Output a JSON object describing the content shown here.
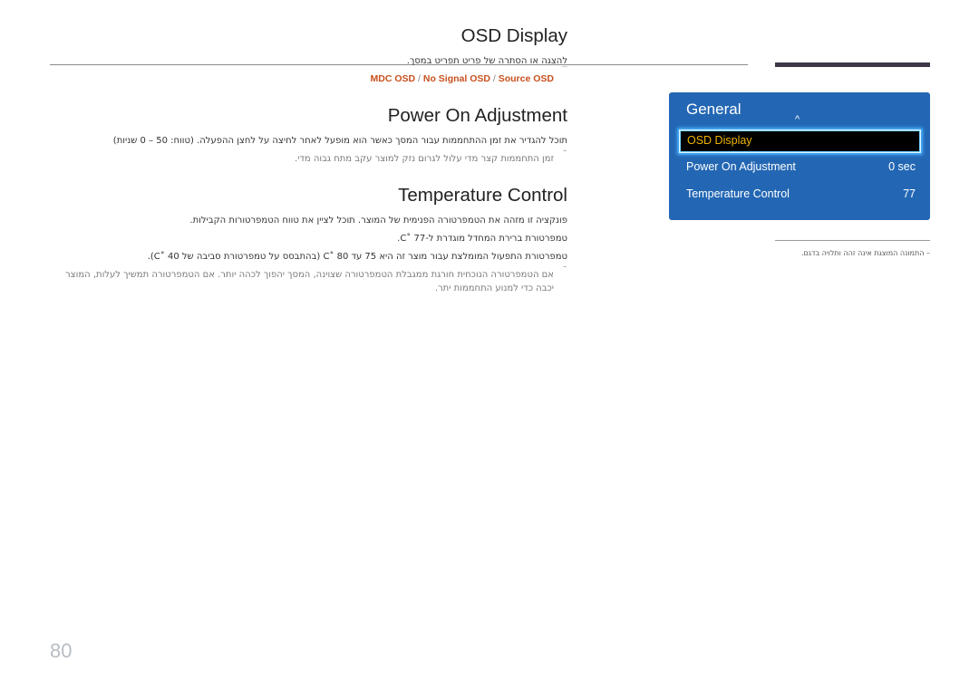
{
  "page_number": "80",
  "sections": {
    "osd_display": {
      "title": "OSD Display",
      "body": "להצגה או הסתרה של פריט תפריט במסך.",
      "options": [
        "MDC OSD",
        "No Signal OSD",
        "Source OSD"
      ],
      "separator": "/"
    },
    "power_on": {
      "title": "Power On Adjustment",
      "body": "תוכל להגדיר את זמן ההתחממות עבור המסך כאשר הוא מופעל לאחר לחיצה על לחצן ההפעלה. (טווח: 50 – 0 שניות)",
      "note": "זמן התחממות קצר מדי עלול לגרום נזק למוצר עקב מתח גבוה מדי."
    },
    "temperature": {
      "title": "Temperature Control",
      "body1": "פונקציה זו מזהה את הטמפרטורה הפנימית של המוצר. תוכל לציין את טווח הטמפרטורות הקבילות.",
      "body2": "טמפרטורת ברירת המחדל מוגדרת ל-C˚ 77.",
      "body3": "טמפרטורת התפעול המומלצת עבור מוצר זה היא 75 עד C˚ 80 (בהתבסס על טמפרטורת סביבה של C˚ 40).",
      "note_line1": "אם הטמפרטורה הנוכחית חורגת ממגבלת הטמפרטורה שצוינה, המסך יהפוך לכהה יותר. אם הטמפרטורה תמשיך לעלות, המוצר",
      "note_line2": "יכבה כדי למנוע התחממות יתר."
    }
  },
  "menu_panel": {
    "title": "General",
    "up_arrow": "^",
    "selected": "OSD Display",
    "items": [
      {
        "label": "Power On Adjustment",
        "value": "0 sec"
      },
      {
        "label": "Temperature Control",
        "value": "77"
      }
    ],
    "colors": {
      "background": "#2367b4",
      "highlight_text": "#f0b300",
      "highlight_bg": "#000000"
    }
  },
  "caption": "– התמונה המוצגת אינה זהה ותלויה בדגם.",
  "colors": {
    "link": "#c8501e",
    "header_bar": "#3d3748"
  }
}
